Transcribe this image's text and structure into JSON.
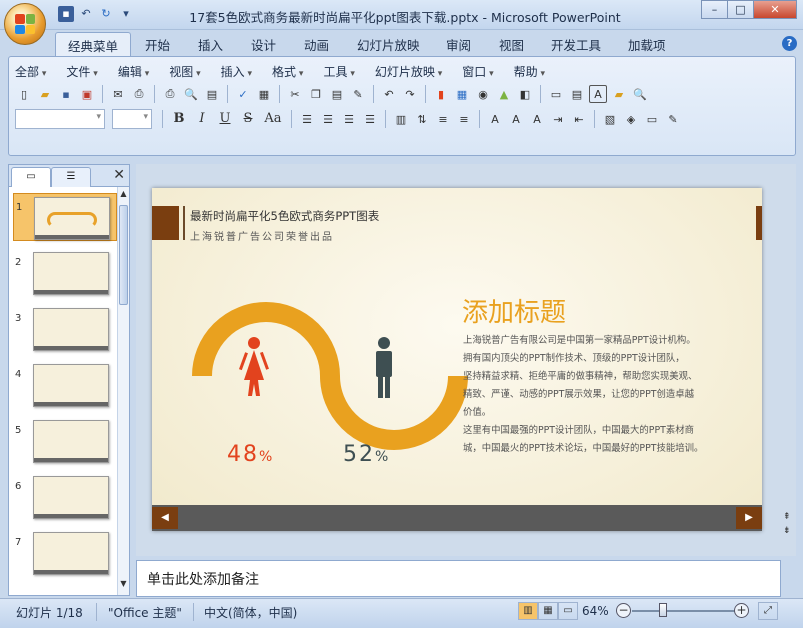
{
  "window": {
    "title": "17套5色欧式商务最新时尚扁平化ppt图表下载.pptx - Microsoft PowerPoint",
    "minimize": "–",
    "maximize": "□",
    "close": "✕"
  },
  "quick_access": [
    "save-icon",
    "undo-icon",
    "redo-icon"
  ],
  "tabs": [
    {
      "label": "经典菜单",
      "active": true
    },
    {
      "label": "开始"
    },
    {
      "label": "插入"
    },
    {
      "label": "设计"
    },
    {
      "label": "动画"
    },
    {
      "label": "幻灯片放映"
    },
    {
      "label": "审阅"
    },
    {
      "label": "视图"
    },
    {
      "label": "开发工具"
    },
    {
      "label": "加载项"
    }
  ],
  "menus": [
    "全部",
    "文件",
    "编辑",
    "视图",
    "插入",
    "格式",
    "工具",
    "幻灯片放映",
    "窗口",
    "帮助"
  ],
  "format_buttons": {
    "bold": "B",
    "italic": "I",
    "underline": "U",
    "strike": "S",
    "case": "Aa"
  },
  "left_pane": {
    "close": "✕",
    "slides": [
      {
        "num": "1",
        "selected": true
      },
      {
        "num": "2"
      },
      {
        "num": "3"
      },
      {
        "num": "4"
      },
      {
        "num": "5"
      },
      {
        "num": "6"
      },
      {
        "num": "7"
      }
    ]
  },
  "slide": {
    "title": "最新时尚扁平化5色欧式商务PPT图表",
    "subtitle": "上海锐普广告公司荣誉出品",
    "heading": "添加标题",
    "body_lines": [
      "上海锐普广告有限公司是中国第一家精品PPT设计机构。",
      "拥有国内顶尖的PPT制作技术、顶级的PPT设计团队，",
      "坚持精益求精、拒绝平庸的做事精神，帮助您实现美观、",
      "精致、严谨、动感的PPT展示效果，让您的PPT创造卓越",
      "价值。",
      "这里有中国最强的PPT设计团队，中国最大的PPT素材商",
      "城，中国最火的PPT技术论坛，中国最好的PPT技能培训。"
    ],
    "female_pct": "48",
    "male_pct": "52",
    "pct_sign": "%",
    "colors": {
      "accent": "#e9a11f",
      "female": "#e2431e",
      "male": "#3e4f52",
      "brown": "#7a3e10"
    }
  },
  "notes_placeholder": "单击此处添加备注",
  "status": {
    "slide_info": "幻灯片 1/18",
    "theme": "\"Office 主题\"",
    "language": "中文(简体，中国)",
    "zoom": "64%"
  }
}
